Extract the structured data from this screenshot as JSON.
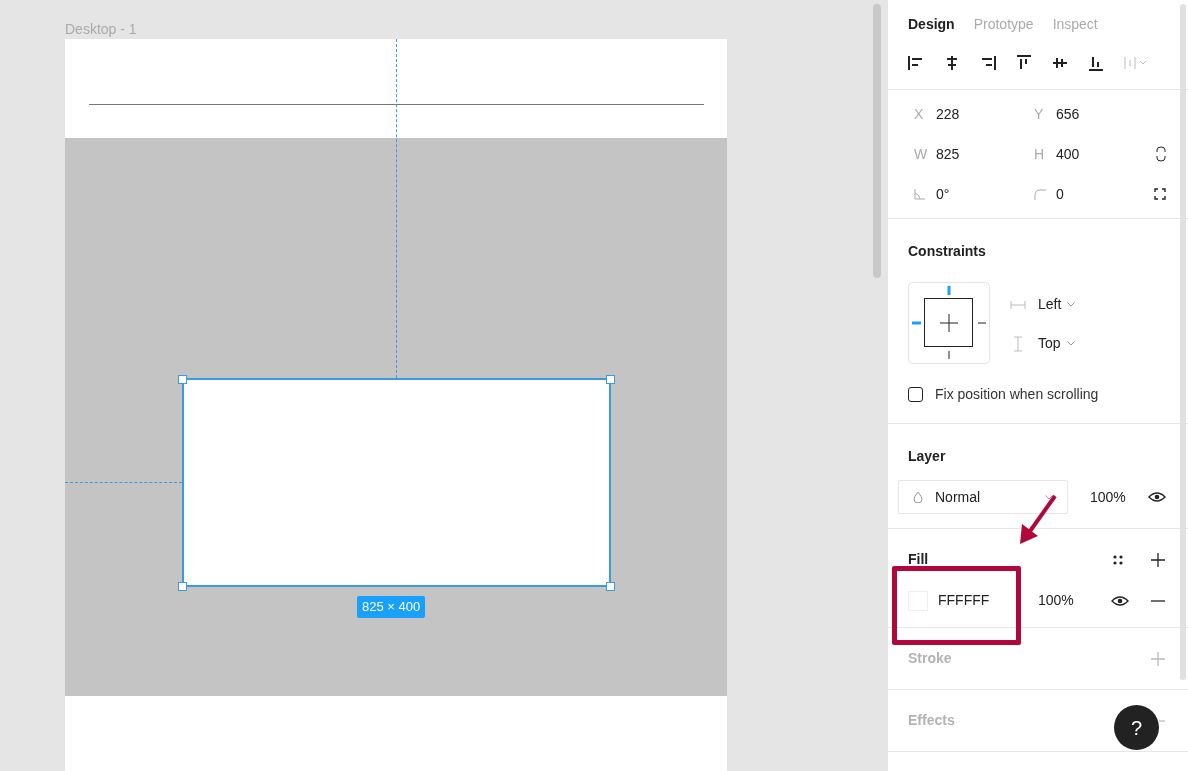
{
  "canvas": {
    "frame_title": "Desktop - 1",
    "size_label": "825 × 400"
  },
  "panel": {
    "tabs": [
      {
        "label": "Design",
        "selected": true
      },
      {
        "label": "Prototype",
        "selected": false
      },
      {
        "label": "Inspect",
        "selected": false
      }
    ],
    "transform": [
      [
        {
          "kind": "letter",
          "label": "X",
          "value": "228"
        },
        {
          "kind": "letter",
          "label": "Y",
          "value": "656"
        }
      ],
      [
        {
          "kind": "letter",
          "label": "W",
          "value": "825"
        },
        {
          "kind": "letter",
          "label": "H",
          "value": "400"
        }
      ],
      [
        {
          "kind": "rotation",
          "value": "0°"
        },
        {
          "kind": "corner-radius",
          "value": "0"
        }
      ]
    ],
    "constraints": {
      "title": "Constraints",
      "horizontal": "Left",
      "vertical": "Top",
      "fix_scrolling": {
        "label": "Fix position when scrolling",
        "checked": false
      }
    },
    "layer": {
      "title": "Layer",
      "blend": "Normal",
      "opacity": "100%",
      "visible": true
    },
    "fill": {
      "title": "Fill",
      "color": "FFFFFF",
      "opacity": "100%",
      "visible": true
    },
    "sections": [
      {
        "title": "Stroke",
        "empty": true
      },
      {
        "title": "Effects",
        "empty": true
      }
    ],
    "help": "?"
  }
}
